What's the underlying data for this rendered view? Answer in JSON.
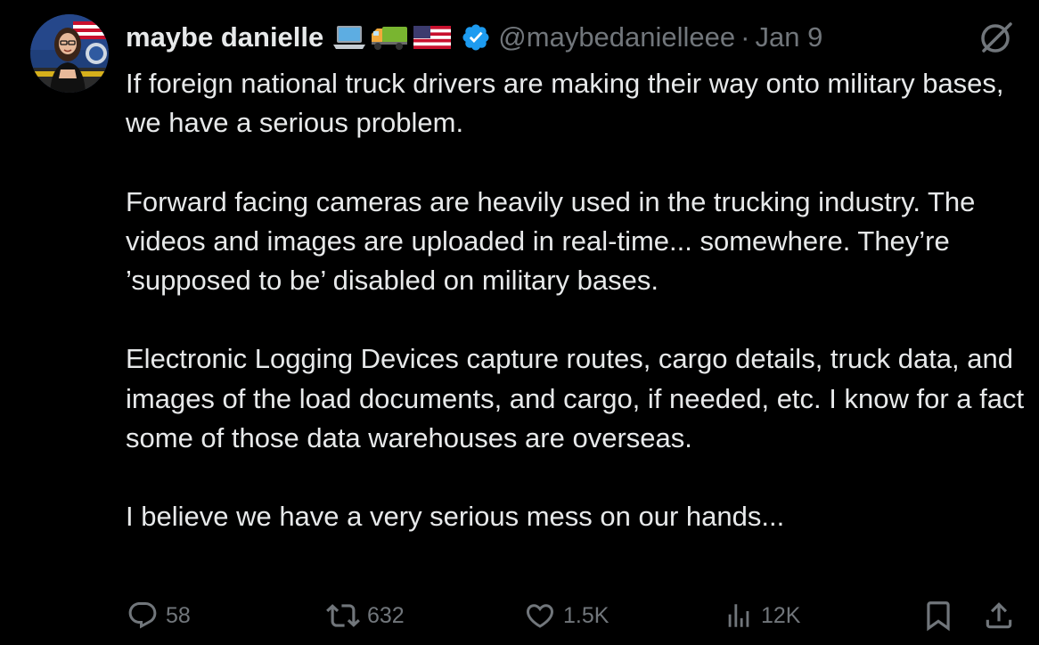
{
  "author": {
    "display_name": "maybe danielle",
    "emoji_icons": [
      "laptop-emoji",
      "delivery-truck-emoji",
      "us-flag-emoji"
    ],
    "verified": true,
    "handle": "@maybedanielleee",
    "separator": "·",
    "date": "Jan 9",
    "avatar": "profile-photo"
  },
  "tweet": {
    "paragraphs": [
      "If foreign national truck drivers are making their way onto military bases, we have a serious problem.",
      "Forward facing cameras are heavily used in the trucking industry. The videos and images are uploaded in real-time... somewhere. They’re ’supposed to be’ disabled on military bases.",
      "Electronic Logging Devices capture routes, cargo details, truck data, and images of the load documents, and cargo, if needed, etc. I know for a fact some of those data warehouses are overseas.",
      "I believe we have a very serious mess on our hands..."
    ]
  },
  "actions": {
    "replies": "58",
    "reposts": "632",
    "likes": "1.5K",
    "views": "12K"
  },
  "icons": {
    "reply": "reply-icon",
    "repost": "repost-icon",
    "like": "heart-icon",
    "views": "views-chart-icon",
    "bookmark": "bookmark-icon",
    "share": "share-icon",
    "grok": "grok-icon",
    "verified": "verified-badge-icon"
  },
  "colors": {
    "background": "#000000",
    "text": "#e7e9ea",
    "secondary": "#71767b",
    "verified": "#1d9bf0"
  }
}
